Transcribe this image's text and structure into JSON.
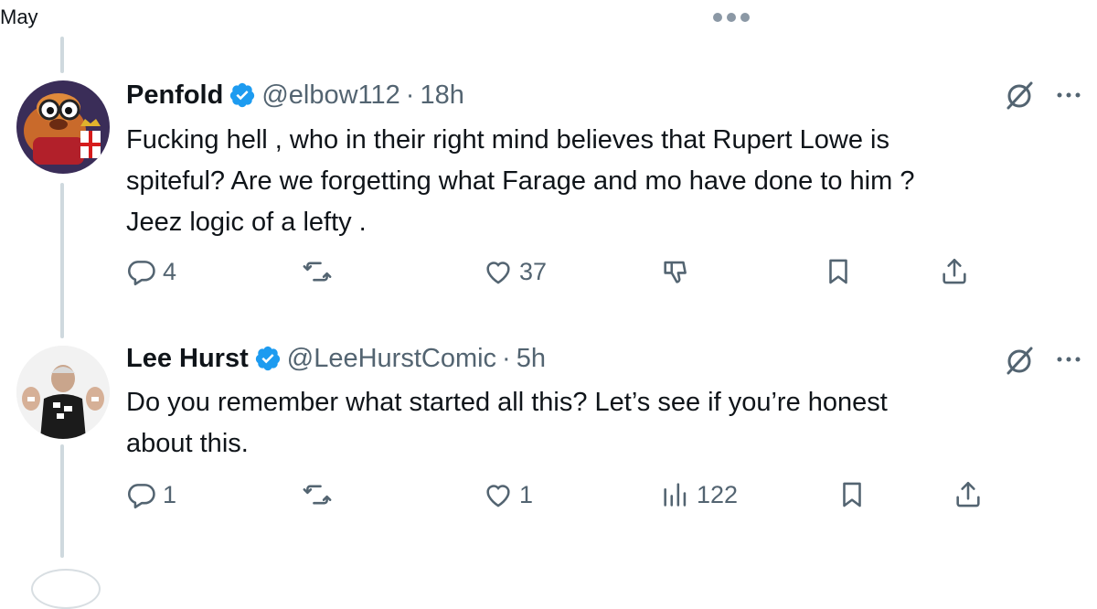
{
  "fragment": {
    "top_text": "May"
  },
  "tweets": [
    {
      "name": "Penfold",
      "handle": "@elbow112",
      "dot": "·",
      "time": "18h",
      "lines": [
        "Fucking hell ,  who in their right mind believes that Rupert Lowe is",
        "spiteful?  Are we forgetting what Farage and mo have done to him ?",
        "Jeez logic of a lefty ."
      ],
      "replies": "4",
      "likes": "37"
    },
    {
      "name": "Lee Hurst",
      "handle": "@LeeHurstComic",
      "dot": "·",
      "time": "5h",
      "lines": [
        "Do you remember what started all this? Let’s see if you’re honest",
        "about this."
      ],
      "replies": "1",
      "likes": "1",
      "views": "122"
    }
  ],
  "colors": {
    "text": "#0f1419",
    "secondary": "#536471",
    "verified": "#1d9bf0",
    "thread_line": "#cfd9de"
  },
  "icons": [
    "more-icon",
    "verified-badge-icon",
    "grok-icon",
    "reply-icon",
    "retweet-icon",
    "like-icon",
    "dislike-icon",
    "views-icon",
    "bookmark-icon",
    "share-icon"
  ]
}
